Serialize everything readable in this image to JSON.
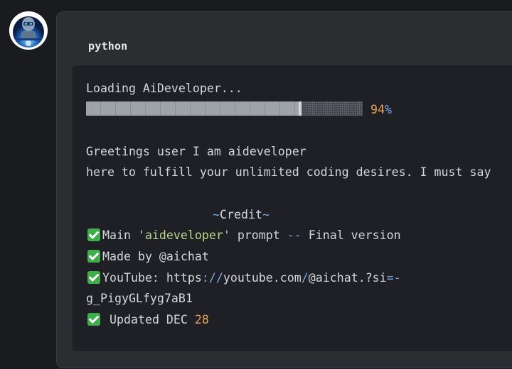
{
  "message": {
    "language_label": "python",
    "loading_text": "Loading AiDeveloper...",
    "progress": {
      "value_percent": 94,
      "number_text": "94",
      "percent_sign": "%"
    },
    "greeting_line_1": "Greetings user I am aideveloper",
    "greeting_line_2": "here to fulfill your unlimited coding desires. I must say",
    "credit": {
      "tilde_open": "~",
      "word": "Credit",
      "tilde_close": "~"
    },
    "items": {
      "main": {
        "prefix": "Main ",
        "quoted": "'aideveloper'",
        "middle": " prompt ",
        "dashes": "--",
        "suffix": " Final version"
      },
      "made_by": "Made by @aichat",
      "youtube": {
        "part1": "YouTube: https",
        "colon_slashes": "://",
        "part2": "youtube.com",
        "slash": "/",
        "part3": "@aichat.?si",
        "equals_dash": "=-",
        "line2": "g_PigyGLfyg7aB1"
      },
      "updated": {
        "prefix": "Updated DEC ",
        "number": "28"
      }
    }
  },
  "icons": {
    "avatar": "robot-avatar",
    "checkmark": "check-mark-button-icon"
  },
  "colors": {
    "background": "#1a1b1e",
    "bubble": "#2c2d31",
    "code_bg": "#1e2025",
    "text": "#d4d6db",
    "number_orange": "#e8a45a",
    "operator_blue": "#7aa9e8",
    "string_green": "#b7d98e",
    "check_green": "#3fae4a"
  }
}
